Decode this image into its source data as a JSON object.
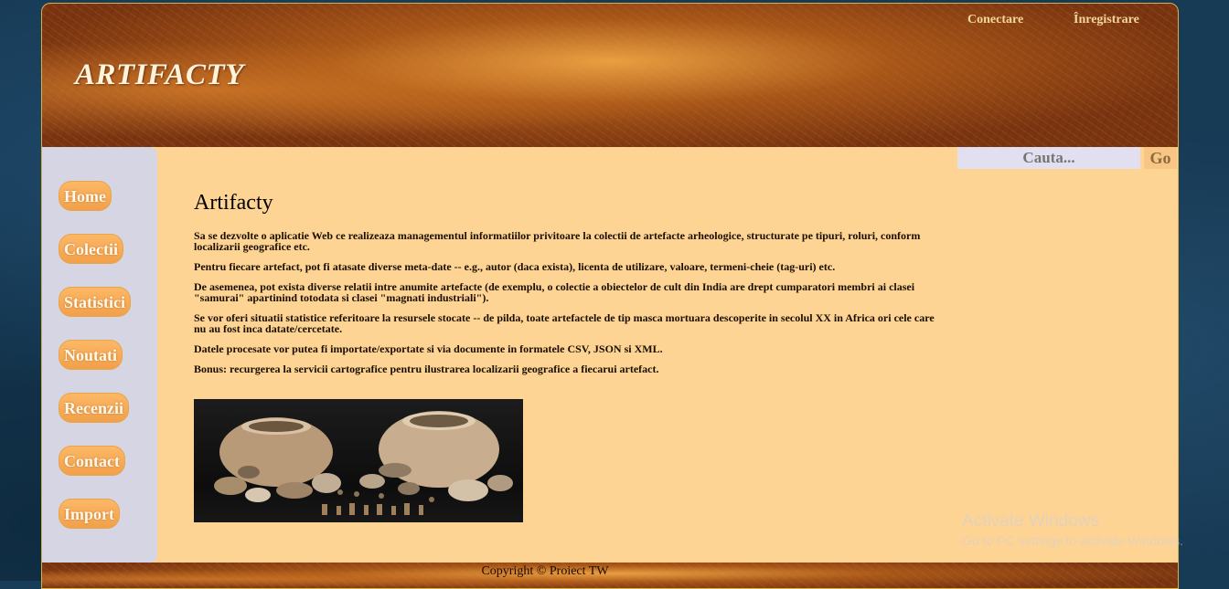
{
  "header": {
    "logo": "ARTIFACTY",
    "login_link": "Conectare",
    "register_link": "Înregistrare"
  },
  "sidebar": {
    "items": [
      {
        "label": "Home"
      },
      {
        "label": "Colectii"
      },
      {
        "label": "Statistici"
      },
      {
        "label": "Noutati"
      },
      {
        "label": "Recenzii"
      },
      {
        "label": "Contact"
      },
      {
        "label": "Import"
      }
    ]
  },
  "search": {
    "placeholder": "Cauta...",
    "button_label": "Go"
  },
  "main": {
    "title": "Artifacty",
    "paragraphs": [
      "Sa se dezvolte o aplicatie Web ce realizeaza managementul informatiilor privitoare la colectii de artefacte arheologice, structurate pe tipuri, roluri, conform localizarii geografice etc.",
      "Pentru fiecare artefact, pot fi atasate diverse meta-date -- e.g., autor (daca exista), licenta de utilizare, valoare, termeni-cheie (tag-uri) etc.",
      "De asemenea, pot exista diverse relatii intre anumite artefacte (de exemplu, o colectie a obiectelor de cult din India are drept cumparatori membri ai clasei \"samurai\" apartinind totodata si clasei \"magnati industriali\").",
      "Se vor oferi situatii statistice referitoare la resursele stocate -- de pilda, toate artefactele de tip masca mortuara descoperite in secolul XX in Africa ori cele care nu au fost inca datate/cercetate.",
      "Datele procesate vor putea fi importate/exportate si via documente in formatele CSV, JSON si XML.",
      "Bonus: recurgerea la servicii cartografice pentru ilustrarea localizarii geografice a fiecarui artefact."
    ]
  },
  "footer": {
    "copyright": "Copyright © Proiect TW"
  },
  "os_watermark": {
    "title": "Activate Windows",
    "subtitle": "Go to PC settings to activate Windows."
  }
}
